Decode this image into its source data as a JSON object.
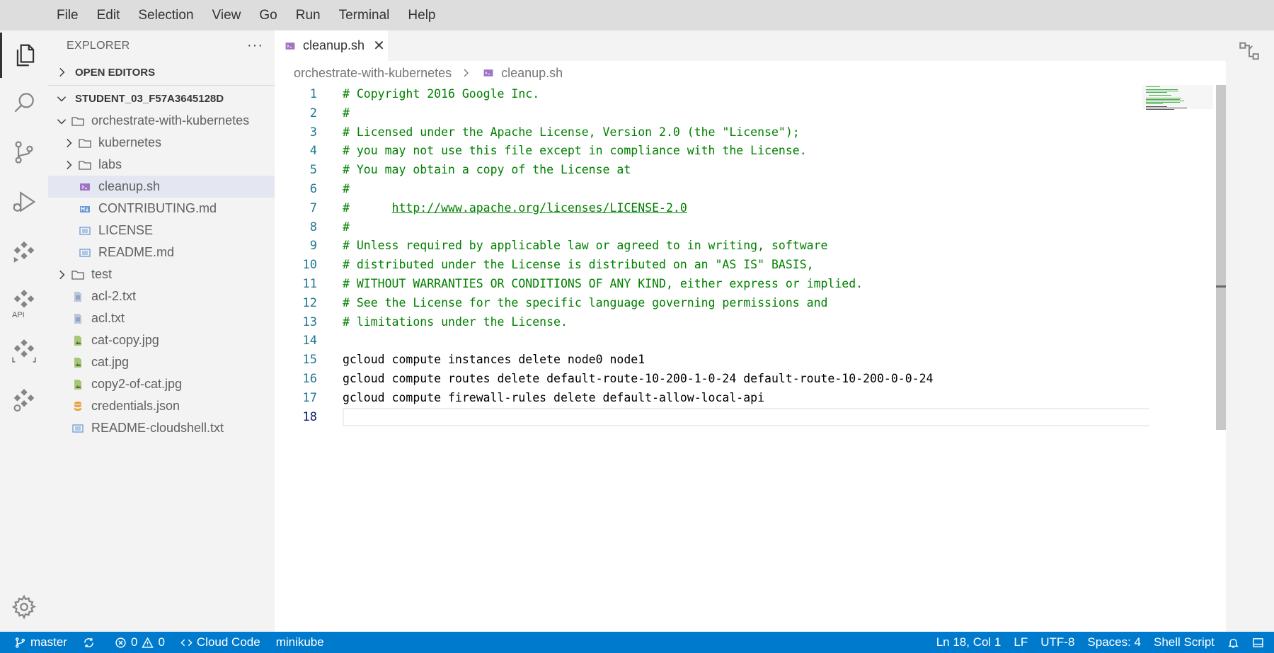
{
  "menu": [
    "File",
    "Edit",
    "Selection",
    "View",
    "Go",
    "Run",
    "Terminal",
    "Help"
  ],
  "activity": {
    "api_label": "API"
  },
  "explorer": {
    "title": "EXPLORER",
    "more": "···",
    "open_editors": "OPEN EDITORS",
    "workspace": "STUDENT_03_F57A3645128D",
    "tree": [
      {
        "label": "orchestrate-with-kubernetes",
        "type": "folder",
        "open": true,
        "depth": 0
      },
      {
        "label": "kubernetes",
        "type": "folder",
        "open": false,
        "depth": 1
      },
      {
        "label": "labs",
        "type": "folder",
        "open": false,
        "depth": 1
      },
      {
        "label": "cleanup.sh",
        "type": "shell",
        "depth": 1,
        "selected": true
      },
      {
        "label": "CONTRIBUTING.md",
        "type": "markdown",
        "depth": 1
      },
      {
        "label": "LICENSE",
        "type": "text",
        "depth": 1
      },
      {
        "label": "README.md",
        "type": "text",
        "depth": 1
      },
      {
        "label": "test",
        "type": "folder",
        "open": false,
        "depth": 0
      },
      {
        "label": "acl-2.txt",
        "type": "file",
        "depth": 0
      },
      {
        "label": "acl.txt",
        "type": "file",
        "depth": 0
      },
      {
        "label": "cat-copy.jpg",
        "type": "image",
        "depth": 0
      },
      {
        "label": "cat.jpg",
        "type": "image",
        "depth": 0
      },
      {
        "label": "copy2-of-cat.jpg",
        "type": "image",
        "depth": 0
      },
      {
        "label": "credentials.json",
        "type": "json",
        "depth": 0
      },
      {
        "label": "README-cloudshell.txt",
        "type": "text",
        "depth": 0
      }
    ]
  },
  "tab": {
    "label": "cleanup.sh",
    "close": "✕"
  },
  "breadcrumb": {
    "folder": "orchestrate-with-kubernetes",
    "file": "cleanup.sh"
  },
  "editor": {
    "lines": [
      "# Copyright 2016 Google Inc.",
      "#",
      "# Licensed under the Apache License, Version 2.0 (the \"License\");",
      "# you may not use this file except in compliance with the License.",
      "# You may obtain a copy of the License at",
      "#",
      "#      http://www.apache.org/licenses/LICENSE-2.0",
      "#",
      "# Unless required by applicable law or agreed to in writing, software",
      "# distributed under the License is distributed on an \"AS IS\" BASIS,",
      "# WITHOUT WARRANTIES OR CONDITIONS OF ANY KIND, either express or implied.",
      "# See the License for the specific language governing permissions and",
      "# limitations under the License.",
      "",
      "gcloud compute instances delete node0 node1",
      "gcloud compute routes delete default-route-10-200-1-0-24 default-route-10-200-0-0-24",
      "gcloud compute firewall-rules delete default-allow-local-api",
      ""
    ],
    "link_text": "http://www.apache.org/licenses/LICENSE-2.0",
    "active_line": 18
  },
  "status": {
    "branch": "master",
    "errors": "0",
    "warnings": "0",
    "cloud_code": "Cloud Code",
    "minikube": "minikube",
    "position": "Ln 18, Col 1",
    "eol": "LF",
    "encoding": "UTF-8",
    "spaces": "Spaces: 4",
    "language": "Shell Script"
  },
  "colors": {
    "status_bar": "#007acc",
    "comment": "#008000",
    "line_number": "#237893",
    "selected_row": "#e4e6f1"
  }
}
